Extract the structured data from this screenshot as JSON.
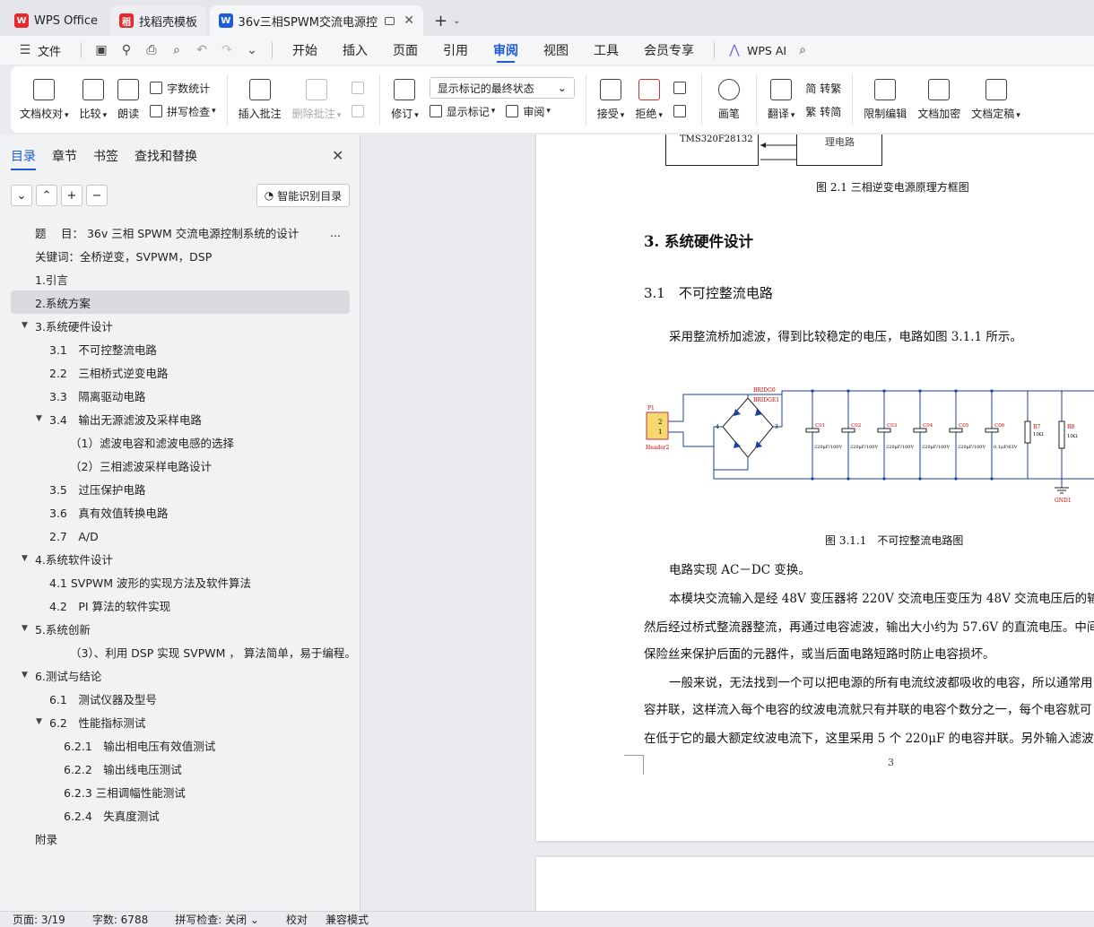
{
  "tabs": [
    {
      "label": "WPS Office"
    },
    {
      "label": "找稻壳模板"
    },
    {
      "label": "36v三相SPWM交流电源控制系"
    }
  ],
  "menu": {
    "file": "文件",
    "items": [
      "开始",
      "插入",
      "页面",
      "引用",
      "审阅",
      "视图",
      "工具",
      "会员专享"
    ],
    "active": "审阅",
    "ai": "WPS AI"
  },
  "ribbon": {
    "doc_check": "文档校对",
    "compare": "比较",
    "read_aloud": "朗读",
    "word_count": "字数统计",
    "spell_check": "拼写检查",
    "insert_comment": "插入批注",
    "delete_comment": "删除批注",
    "revise": "修订",
    "display_state": "显示标记的最终状态",
    "show_markup": "显示标记",
    "review": "审阅",
    "accept": "接受",
    "reject": "拒绝",
    "pen": "画笔",
    "translate": "翻译",
    "to_trad": "简 转繁",
    "to_simp": "繁 转简",
    "restrict": "限制编辑",
    "encrypt": "文档加密",
    "finalize": "文档定稿"
  },
  "nav": {
    "tabs": [
      "目录",
      "章节",
      "书签",
      "查找和替换"
    ],
    "active_tab": "目录",
    "smart_btn": "智能识别目录",
    "toc": [
      {
        "text": "题　 目： 36v 三相 SPWM 交流电源控制系统的设计",
        "level": 0
      },
      {
        "text": "关键词：全桥逆变，SVPWM，DSP",
        "level": 0
      },
      {
        "text": "1.引言",
        "level": 0
      },
      {
        "text": "2.系统方案",
        "level": 0
      },
      {
        "text": "3.系统硬件设计",
        "level": 0
      },
      {
        "text": "3.1　不可控整流电路",
        "level": 1
      },
      {
        "text": "2.2　三相桥式逆变电路",
        "level": 1
      },
      {
        "text": "3.3　隔离驱动电路",
        "level": 1
      },
      {
        "text": "3.4　输出无源滤波及采样电路",
        "level": 1
      },
      {
        "text": "（1）滤波电容和滤波电感的选择",
        "level": 2
      },
      {
        "text": "（2）三相滤波采样电路设计",
        "level": 2
      },
      {
        "text": "3.5　过压保护电路",
        "level": 1
      },
      {
        "text": "3.6　真有效值转换电路",
        "level": 1
      },
      {
        "text": "2.7　A/D",
        "level": 1
      },
      {
        "text": "4.系统软件设计",
        "level": 0
      },
      {
        "text": "4.1 SVPWM 波形的实现方法及软件算法",
        "level": 1
      },
      {
        "text": "4.2　PI 算法的软件实现",
        "level": 1
      },
      {
        "text": "5.系统创新",
        "level": 0
      },
      {
        "text": "（3）、利用 DSP 实现 SVPWM ， 算法简单，易于编程。",
        "level": 2
      },
      {
        "text": "6.测试与结论",
        "level": 0
      },
      {
        "text": "6.1　测试仪器及型号",
        "level": 1
      },
      {
        "text": "6.2　性能指标测试",
        "level": 1
      },
      {
        "text": "6.2.1　输出相电压有效值测试",
        "level": 3
      },
      {
        "text": "6.2.2　输出线电压测试",
        "level": 3
      },
      {
        "text": "6.2.3 三相调幅性能测试",
        "level": 3
      },
      {
        "text": "6.2.4　失真度测试",
        "level": 3
      },
      {
        "text": "附录",
        "level": 0
      }
    ]
  },
  "doc": {
    "fig_top_chip": "TMS320F28132",
    "fig_top_box": "理电路",
    "fig21_caption": "图 2.1  三相逆变电源原理方框图",
    "h3": "3.  系统硬件设计",
    "h31": "3.1　不可控整流电路",
    "p1": "采用整流桥加滤波，得到比较稳定的电压，电路如图 3.1.1 所示。",
    "fig311_caption": "图 3.1.1　不可控整流电路图",
    "p2": "电路实现 AC－DC 变换。",
    "p3a": "本模块交流输入是经 48V 变压器将 220V 交流电压变压为 48V 交流电压后的输",
    "p3b": "然后经过桥式整流器整流，再通过电容滤波，输出大小约为 57.6V 的直流电压。中间",
    "p3c": "保险丝来保护后面的元器件，或当后面电路短路时防止电容损坏。",
    "p4a": "一般来说，无法找到一个可以把电源的所有电流纹波都吸收的电容，所以通常用",
    "p4b": "容并联，这样流入每个电容的纹波电流就只有并联的电容个数分之一，每个电容就可",
    "p4c": "在低于它的最大额定纹波电流下，这里采用 5 个 220μF 的电容并联。另外输入滤波",
    "page_no": "3",
    "circuit": {
      "bridge1": "BRIDG0",
      "bridge2": "BRIDGE1",
      "p1": "P1",
      "header": "Header2",
      "pin2": "2",
      "pin1": "1",
      "n4": "4",
      "n3": "3",
      "caps": [
        "C01",
        "C02",
        "C03",
        "C04",
        "C05",
        "C06"
      ],
      "capvals": [
        "220μF/100V",
        "220μF/100V",
        "220μF/100V",
        "220μF/100V",
        "220μF/100V",
        "0.1μF/63V"
      ],
      "r7": "R7",
      "r7v": "10Ω",
      "r8": "R8",
      "r8v": "10Ω",
      "gnd": "GND1"
    }
  },
  "status": {
    "page": "页面: 3/19",
    "words": "字数: 6788",
    "spell": "拼写检查: 关闭",
    "proof": "校对",
    "compat": "兼容模式"
  }
}
